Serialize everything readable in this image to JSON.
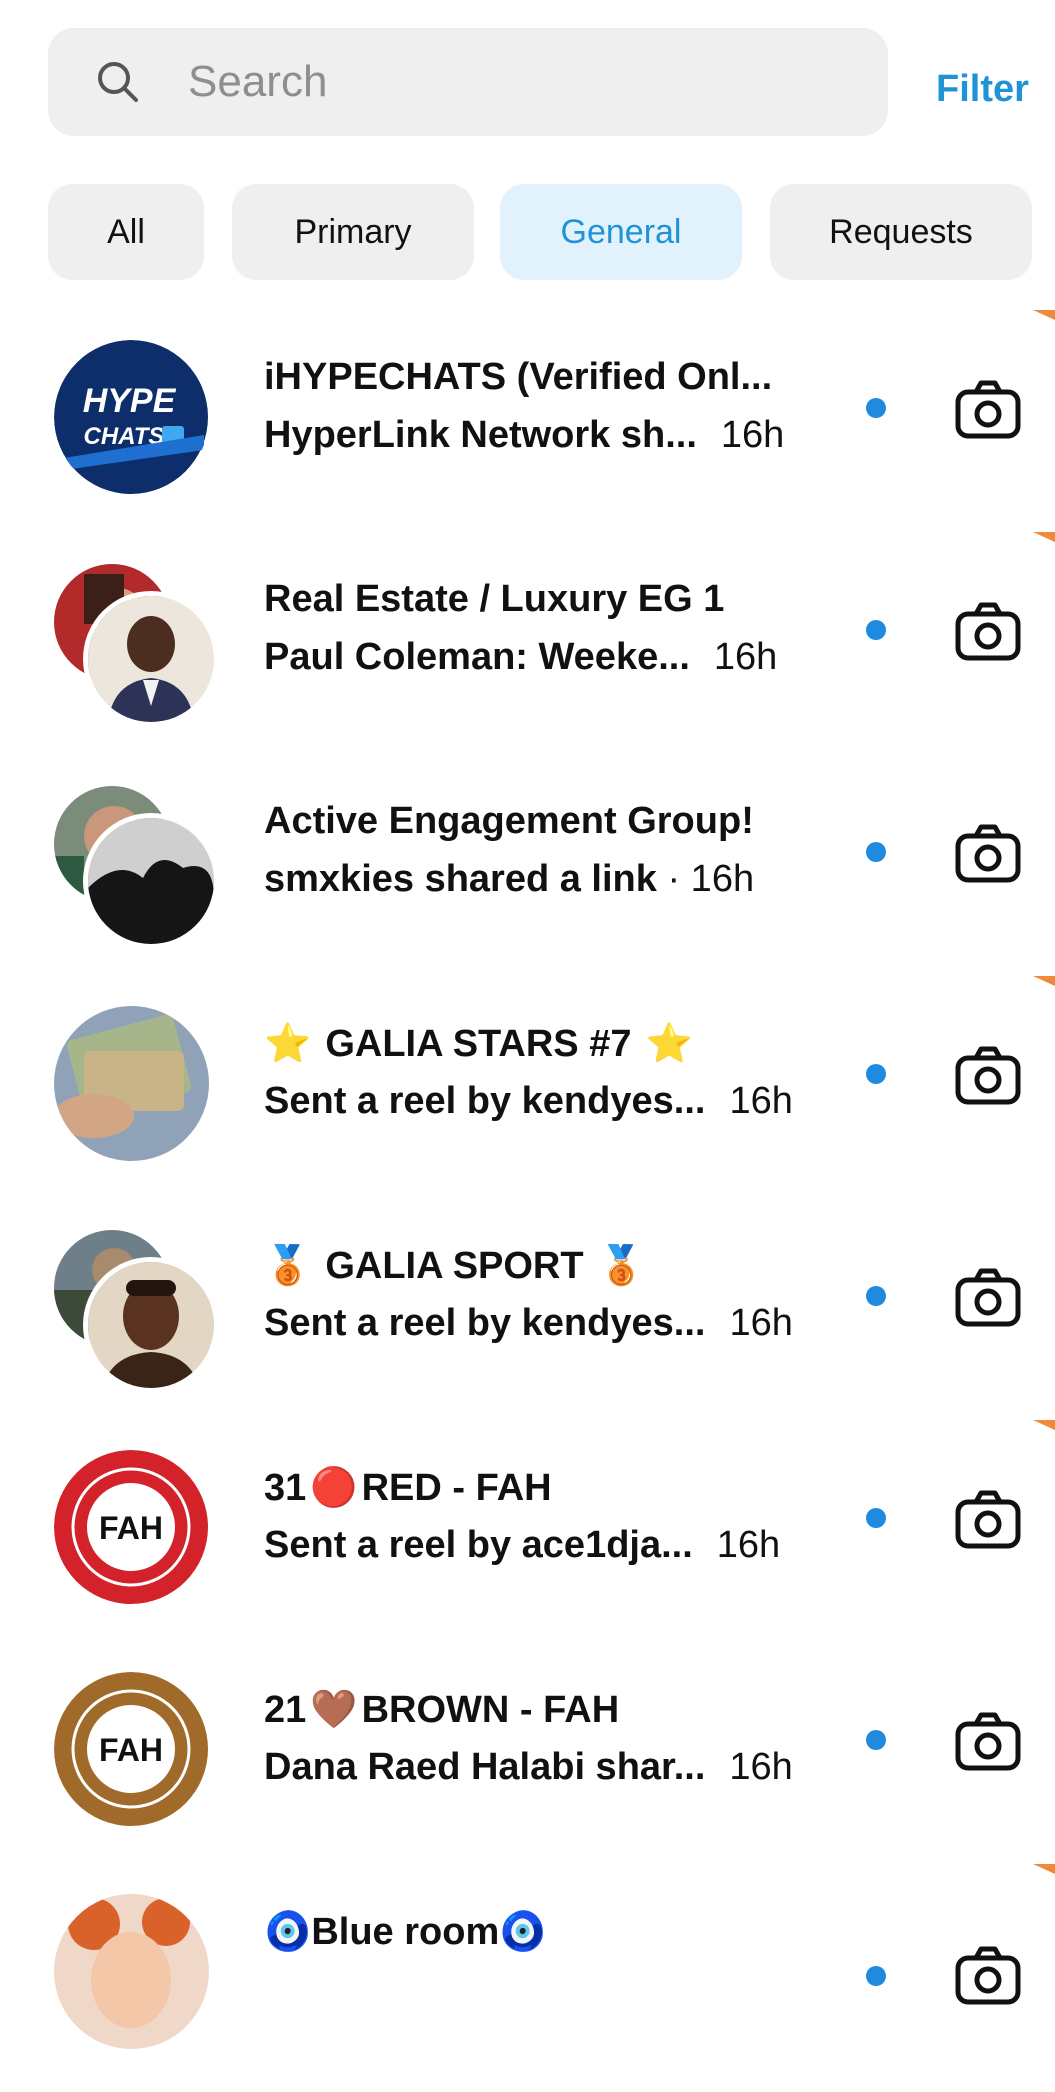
{
  "search": {
    "placeholder": "Search",
    "icon": "search-icon"
  },
  "filter_label": "Filter",
  "tabs": [
    {
      "label": "All",
      "active": false
    },
    {
      "label": "Primary",
      "active": false
    },
    {
      "label": "General",
      "active": true
    },
    {
      "label": "Requests",
      "active": false
    }
  ],
  "conversations": [
    {
      "title": "iHYPECHATS (Verified Onl...",
      "preview": "HyperLink Network sh...",
      "time": "16h",
      "unread": true,
      "avatar": "hypechats-logo",
      "avatar_text": {
        "line1": "HYPE",
        "line2": "CHATS"
      }
    },
    {
      "title": "Real Estate / Luxury EG 1",
      "preview": "Paul Coleman: Weeke...",
      "time": "16h",
      "unread": true,
      "avatar": "group-avatar"
    },
    {
      "title": "Active Engagement Group!",
      "preview": "smxkies shared a link",
      "time": "· 16h",
      "unread": true,
      "avatar": "group-avatar"
    },
    {
      "title_prefix_emoji": "⭐",
      "title": "GALIA STARS #7",
      "title_suffix_emoji": "⭐",
      "preview": "Sent a reel by kendyes...",
      "time": "16h",
      "unread": true,
      "avatar": "money-photo"
    },
    {
      "title_prefix_emoji": "🥉",
      "title": "GALIA SPORT",
      "title_suffix_emoji": "🥉",
      "preview": "Sent a reel by kendyes...",
      "time": "16h",
      "unread": true,
      "avatar": "group-avatar"
    },
    {
      "title_num": "31",
      "title_emoji": "🔴",
      "title": "RED - FAH",
      "preview": "Sent a reel by ace1dja...",
      "time": "16h",
      "unread": true,
      "avatar": "fah-red-logo",
      "avatar_text": "FAH"
    },
    {
      "title_num": "21",
      "title_emoji": "🤎",
      "title": "BROWN - FAH",
      "preview": "Dana Raed Halabi shar...",
      "time": "16h",
      "unread": true,
      "avatar": "fah-brown-logo",
      "avatar_text": "FAH"
    },
    {
      "title_prefix_emoji": "🧿",
      "title": "Blue room",
      "title_suffix_emoji": "🧿",
      "unread": true,
      "avatar": "person-photo"
    }
  ],
  "colors": {
    "accent": "#1f93d6",
    "unread_dot": "#1f8be0",
    "tab_bg": "#efefef",
    "tab_active_bg": "#e2f2fd",
    "fah_red": "#d3222a",
    "fah_brown": "#a06a2a"
  },
  "icons": {
    "camera": "camera-icon",
    "unread": "unread-dot"
  }
}
